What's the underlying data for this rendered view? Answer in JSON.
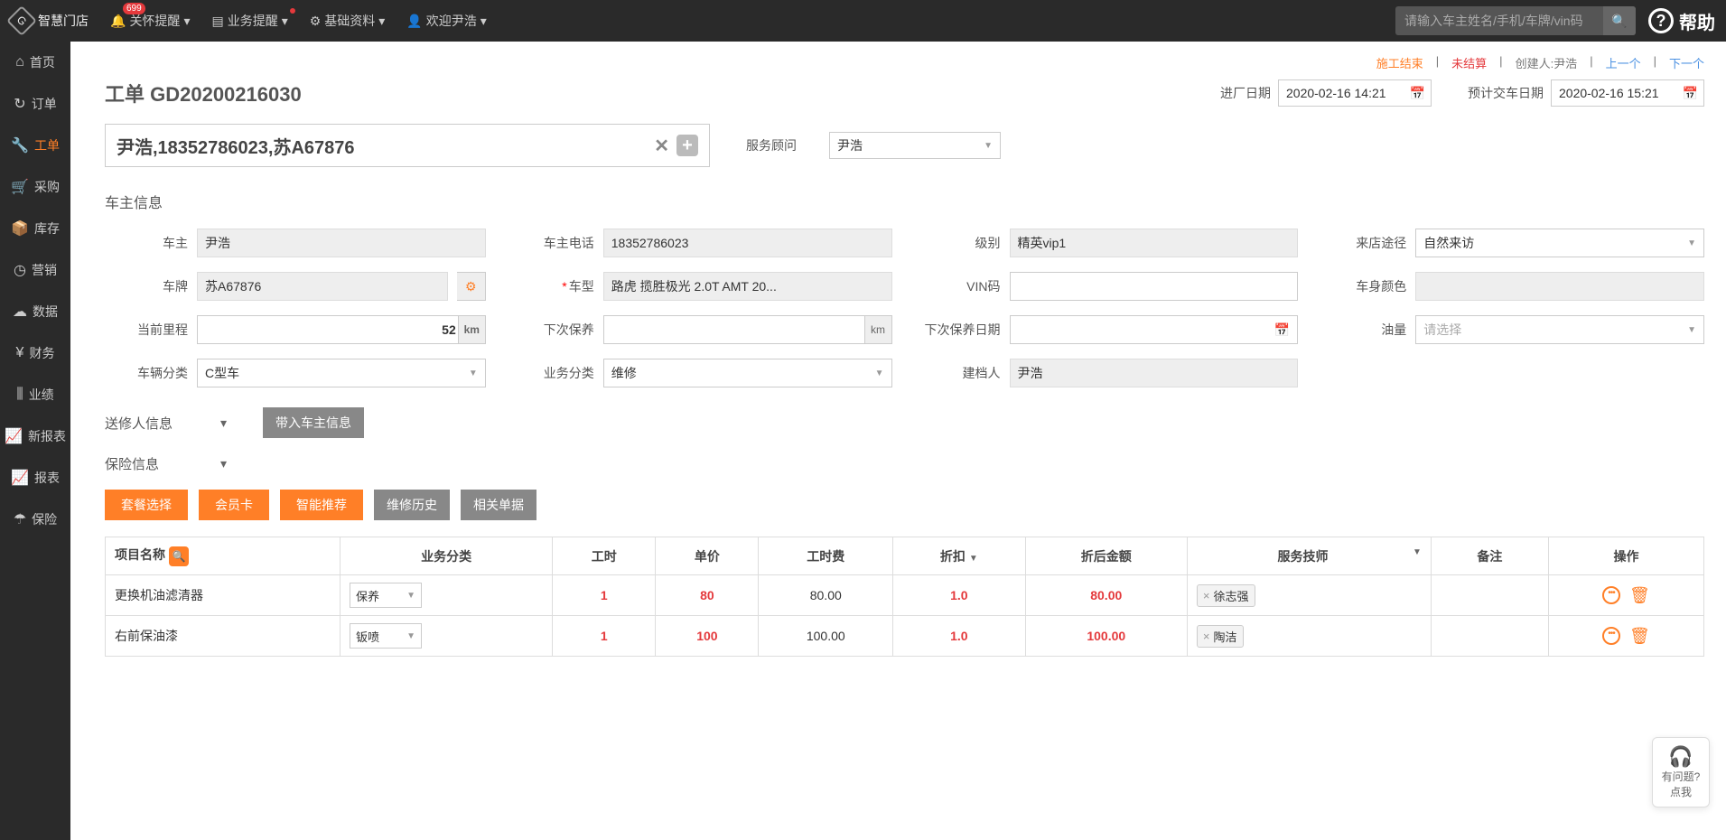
{
  "topbar": {
    "brand": "智慧门店",
    "nav": [
      {
        "label": "关怀提醒",
        "badge": "699"
      },
      {
        "label": "业务提醒",
        "dot": true
      },
      {
        "label": "基础资料"
      },
      {
        "label": "欢迎尹浩"
      }
    ],
    "search_placeholder": "请输入车主姓名/手机/车牌/vin码",
    "help": "帮助"
  },
  "sidebar": [
    {
      "label": "首页"
    },
    {
      "label": "订单"
    },
    {
      "label": "工单",
      "active": true
    },
    {
      "label": "采购"
    },
    {
      "label": "库存"
    },
    {
      "label": "营销"
    },
    {
      "label": "数据"
    },
    {
      "label": "财务"
    },
    {
      "label": "业绩"
    },
    {
      "label": "新报表"
    },
    {
      "label": "报表"
    },
    {
      "label": "保险"
    }
  ],
  "status": {
    "state1": "施工结束",
    "state2": "未结算",
    "creator": "创建人:尹浩",
    "prev": "上一个",
    "next": "下一个"
  },
  "header": {
    "title": "工单 GD20200216030",
    "enter_label": "进厂日期",
    "enter_value": "2020-02-16 14:21",
    "expect_label": "预计交车日期",
    "expect_value": "2020-02-16 15:21"
  },
  "customer": {
    "summary": "尹浩,18352786023,苏A67876",
    "advisor_label": "服务顾问",
    "advisor_value": "尹浩"
  },
  "owner_section_title": "车主信息",
  "fields": {
    "owner_l": "车主",
    "owner_v": "尹浩",
    "phone_l": "车主电话",
    "phone_v": "18352786023",
    "level_l": "级别",
    "level_v": "精英vip1",
    "source_l": "来店途径",
    "source_v": "自然来访",
    "plate_l": "车牌",
    "plate_v": "苏A67876",
    "model_l": "车型",
    "model_v": "路虎 揽胜极光 2.0T AMT 20...",
    "vin_l": "VIN码",
    "vin_v": "",
    "color_l": "车身颜色",
    "color_v": "",
    "mileage_l": "当前里程",
    "mileage_v": "52",
    "km": "km",
    "next_maint_l": "下次保养",
    "next_maint_v": "",
    "next_maint_date_l": "下次保养日期",
    "next_maint_date_v": "",
    "fuel_l": "油量",
    "fuel_v": "请选择",
    "vclass_l": "车辆分类",
    "vclass_v": "C型车",
    "bclass_l": "业务分类",
    "bclass_v": "维修",
    "creator_l": "建档人",
    "creator_v": "尹浩"
  },
  "collapsers": {
    "sender": "送修人信息",
    "import_btn": "带入车主信息",
    "insurance": "保险信息"
  },
  "btns": {
    "pkg": "套餐选择",
    "member": "会员卡",
    "ai": "智能推荐",
    "history": "维修历史",
    "related": "相关单据"
  },
  "table": {
    "headers": {
      "name": "项目名称",
      "bclass": "业务分类",
      "hours": "工时",
      "price": "单价",
      "hourfee": "工时费",
      "discount": "折扣",
      "after": "折后金额",
      "tech": "服务技师",
      "remark": "备注",
      "op": "操作"
    },
    "rows": [
      {
        "name": "更换机油滤清器",
        "bclass": "保养",
        "hours": "1",
        "price": "80",
        "hourfee": "80.00",
        "discount": "1.0",
        "after": "80.00",
        "tech": "徐志强"
      },
      {
        "name": "右前保油漆",
        "bclass": "钣喷",
        "hours": "1",
        "price": "100",
        "hourfee": "100.00",
        "discount": "1.0",
        "after": "100.00",
        "tech": "陶洁"
      }
    ]
  },
  "float_help": {
    "line1": "有问题?",
    "line2": "点我"
  }
}
